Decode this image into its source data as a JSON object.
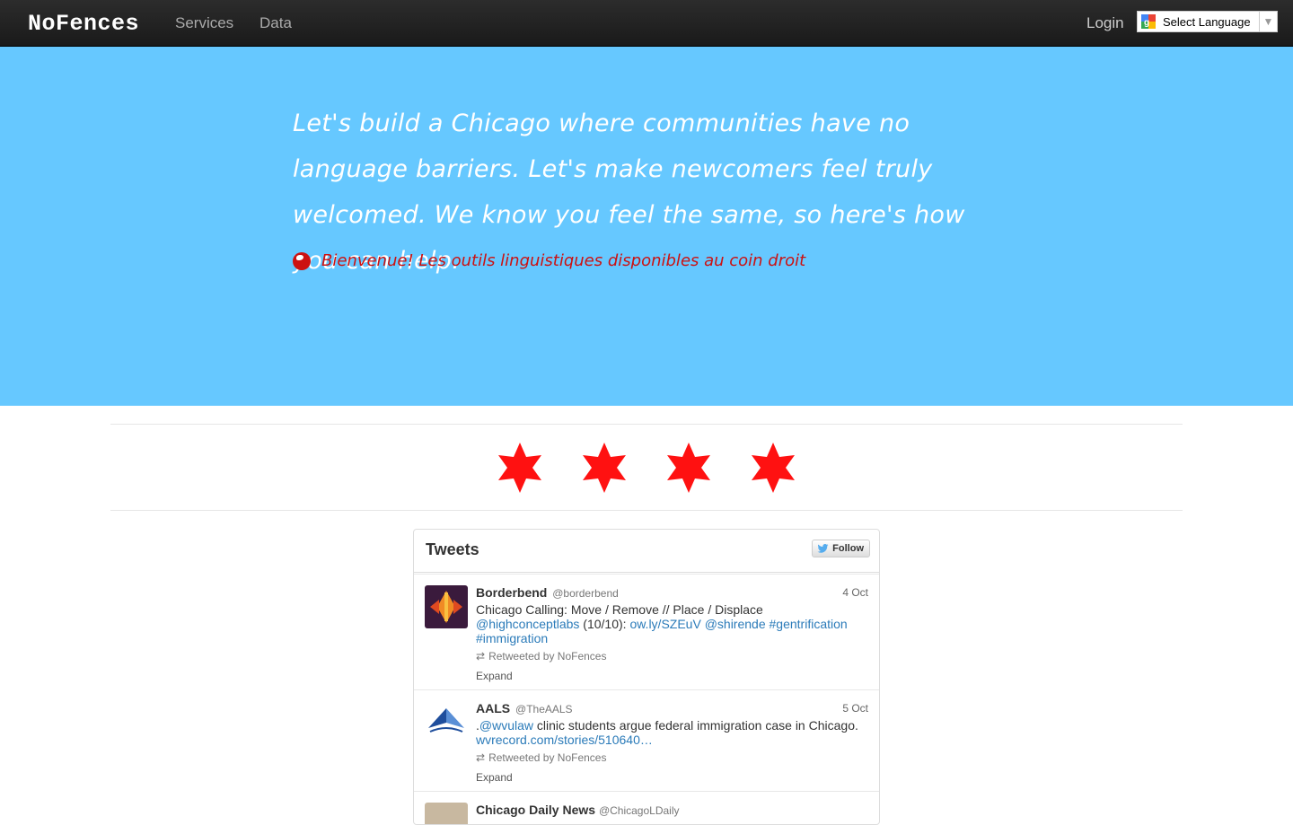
{
  "navbar": {
    "brand": "NoFences",
    "links": [
      "Services",
      "Data"
    ],
    "login": "Login",
    "language_select": "Select Language"
  },
  "hero": {
    "headline": "Let's build a Chicago where communities have no language barriers. Let's make newcomers feel truly welcomed. We know you feel the same, so here's how you can help.",
    "welcome": "Bienvenue! Les outils linguistiques disponibles au coin droit",
    "welcome_icon": "globe-icon",
    "background_color": "#66c8ff",
    "welcome_color": "#cc1111"
  },
  "stars": {
    "count": 4,
    "color": "#ff1111",
    "icon": "six-pointed-star-icon"
  },
  "twitter": {
    "title": "Tweets",
    "follow_label": "Follow",
    "tweets": [
      {
        "name": "Borderbend",
        "handle": "@borderbend",
        "date": "4 Oct",
        "text": "Chicago Calling: Move / Remove // Place / Displace",
        "links": [
          "@highconceptlabs",
          "(10/10):",
          "ow.ly/SZEuV",
          "@shirende",
          "#gentrification",
          "#immigration"
        ],
        "retweeted_by": "Retweeted by NoFences",
        "expand": "Expand"
      },
      {
        "name": "AALS",
        "handle": "@TheAALS",
        "date": "5 Oct",
        "text_prefix": ".",
        "mention": "@wvulaw",
        "text": "clinic students argue federal immigration case in Chicago.",
        "link": "wvrecord.com/stories/510640…",
        "retweeted_by": "Retweeted by NoFences",
        "expand": "Expand"
      },
      {
        "name": "Chicago Daily News",
        "handle": "@ChicagoLDaily"
      }
    ]
  }
}
